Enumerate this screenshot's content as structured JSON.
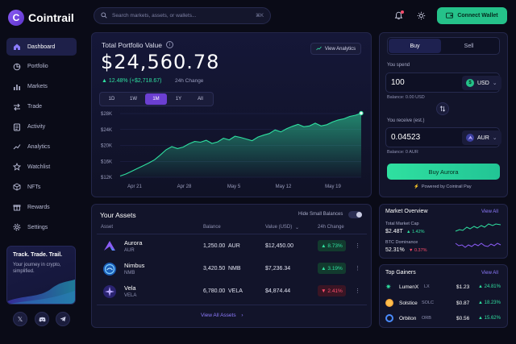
{
  "app": {
    "name": "Cointrail",
    "logo_letter": "C"
  },
  "sidebar": {
    "items": [
      {
        "label": "Dashboard",
        "icon": "home-icon",
        "active": true
      },
      {
        "label": "Portfolio",
        "icon": "pie-chart-icon"
      },
      {
        "label": "Markets",
        "icon": "chart-bars-icon"
      },
      {
        "label": "Trade",
        "icon": "swap-arrows-icon"
      },
      {
        "label": "Activity",
        "icon": "list-icon"
      },
      {
        "label": "Analytics",
        "icon": "trend-line-icon"
      },
      {
        "label": "Watchlist",
        "icon": "star-icon"
      },
      {
        "label": "NFTs",
        "icon": "cube-icon"
      },
      {
        "label": "Rewards",
        "icon": "gift-icon"
      },
      {
        "label": "Settings",
        "icon": "gear-icon"
      }
    ],
    "promo": {
      "title": "Track. Trade. Trail.",
      "subtitle": "Your journey in crypto, simplified."
    },
    "social": [
      "x-icon",
      "discord-icon",
      "telegram-icon"
    ]
  },
  "topbar": {
    "search_placeholder": "Search markets, assets, or wallets...",
    "shortcut": "⌘K",
    "connect_label": "Connect Wallet"
  },
  "portfolio": {
    "title": "Total Portfolio Value",
    "value": "$24,560.78",
    "change": "▲ 12.48% (+$2,718.67)",
    "change_period": "24h Change",
    "view_analytics": "View Analytics",
    "ranges": [
      "1D",
      "1W",
      "1M",
      "1Y",
      "All"
    ],
    "active_range": "1M"
  },
  "chart_data": {
    "type": "area",
    "y_ticks": [
      "$28K",
      "$24K",
      "$20K",
      "$16K",
      "$12K"
    ],
    "ylim": [
      12000,
      28000
    ],
    "x_ticks": [
      "Apr 21",
      "Apr 28",
      "May 5",
      "May 12",
      "May 19"
    ],
    "values": [
      12300,
      12800,
      13500,
      14200,
      14900,
      15600,
      16400,
      17600,
      18900,
      19700,
      19200,
      19600,
      20400,
      21000,
      20800,
      21300,
      20500,
      20900,
      21800,
      21400,
      22300,
      22000,
      21600,
      21200,
      22100,
      22600,
      23000,
      23900,
      23400,
      24200,
      24800,
      25300,
      24700,
      24900,
      25600,
      24900,
      25200,
      25900,
      26400,
      26700,
      27300,
      27600,
      28100
    ],
    "color": "#2fe0a0"
  },
  "assets": {
    "title": "Your Assets",
    "hide_small": "Hide Small Balances",
    "headers": {
      "asset": "Asset",
      "balance": "Balance",
      "value": "Value (USD)",
      "change": "24h Change"
    },
    "rows": [
      {
        "name": "Aurora",
        "symbol": "AUR",
        "balance": "1,250.00",
        "unit": "AUR",
        "value": "$12,450.00",
        "change": "▲ 8.73%",
        "direction": "up",
        "icon": "aurora-logo-icon"
      },
      {
        "name": "Nimbus",
        "symbol": "NMB",
        "balance": "3,420.50",
        "unit": "NMB",
        "value": "$7,236.34",
        "change": "▲ 3.19%",
        "direction": "up",
        "icon": "nimbus-logo-icon"
      },
      {
        "name": "Vela",
        "symbol": "VELA",
        "balance": "6,780.00",
        "unit": "VELA",
        "value": "$4,874.44",
        "change": "▼ 2.41%",
        "direction": "down",
        "icon": "vela-logo-icon"
      }
    ],
    "view_all": "View All Assets"
  },
  "trade": {
    "tabs": [
      "Buy",
      "Sell"
    ],
    "active_tab": "Buy",
    "spend_label": "You spend",
    "spend_value": "100",
    "spend_currency": "USD",
    "spend_balance": "Balance: 0.00 USD",
    "receive_label": "You receive (est.)",
    "receive_value": "0.04523",
    "receive_currency": "AUR",
    "receive_balance": "Balance: 0 AUR",
    "buy_button": "Buy Aurora",
    "powered_by": "Powered by Cointrail Pay"
  },
  "market_overview": {
    "title": "Market Overview",
    "view_all": "View All",
    "stats": [
      {
        "label": "Total Market Cap",
        "value": "$2.48T",
        "change": "▲ 1.42%",
        "direction": "up"
      },
      {
        "label": "BTC Dominance",
        "value": "52.31%",
        "change": "▼ 0.37%",
        "direction": "down"
      }
    ]
  },
  "top_gainers": {
    "title": "Top Gainers",
    "view_all": "View All",
    "rows": [
      {
        "name": "LumenX",
        "symbol": "LX",
        "price": "$1.23",
        "change": "▲ 24.81%"
      },
      {
        "name": "Solstice",
        "symbol": "SOLC",
        "price": "$0.87",
        "change": "▲ 18.23%"
      },
      {
        "name": "Orbiton",
        "symbol": "ORB",
        "price": "$0.56",
        "change": "▲ 15.62%"
      }
    ]
  }
}
